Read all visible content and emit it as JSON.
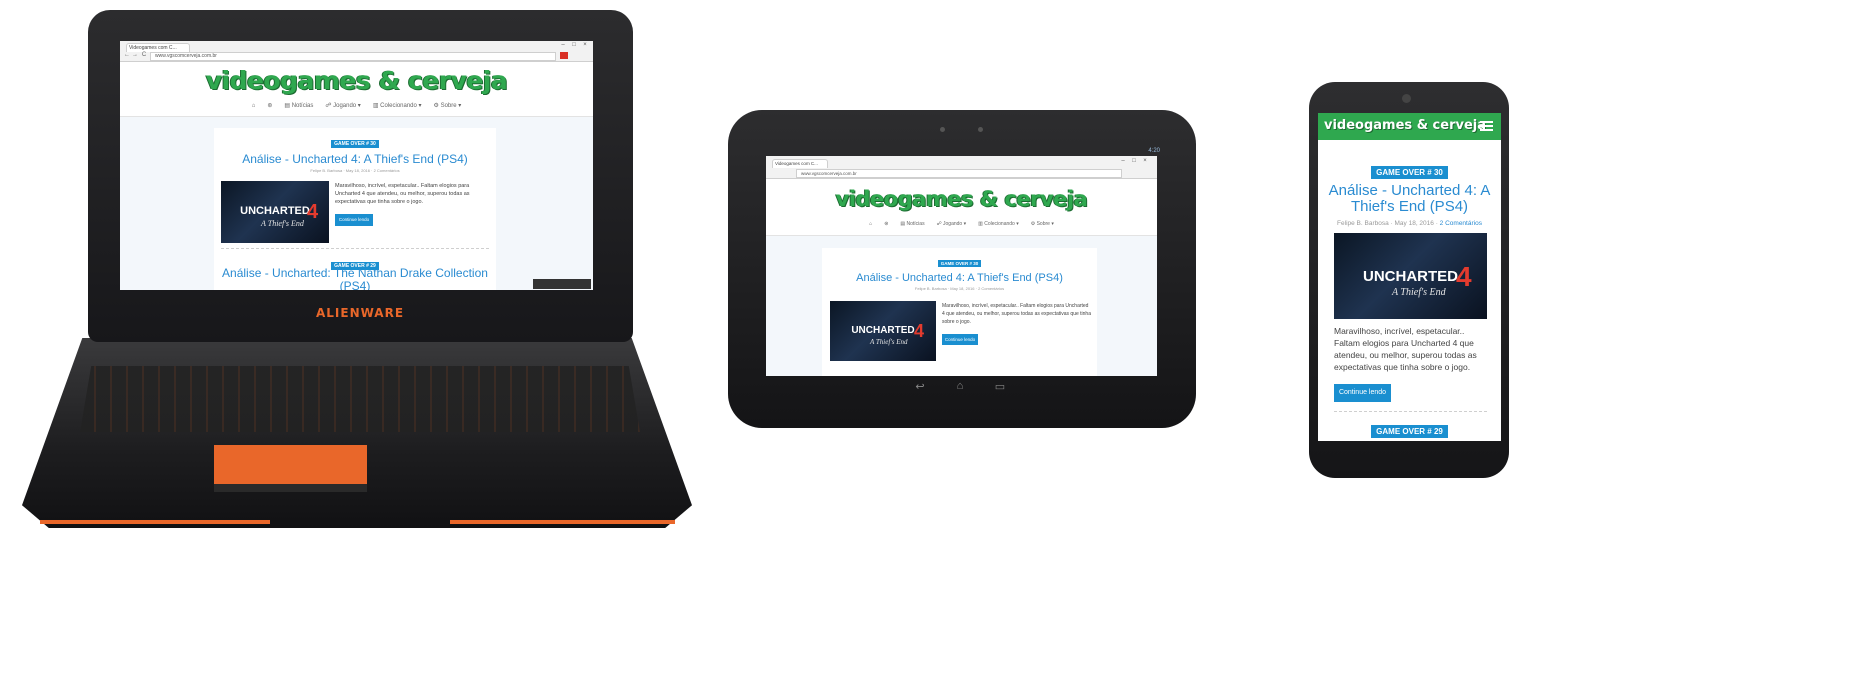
{
  "brand": {
    "laptop_logo": "ALIENWARE",
    "accent": "#e9672a",
    "site_green": "#2fa84f",
    "link_blue": "#2a8bd1",
    "badge_blue": "#1a8fd0"
  },
  "browser": {
    "tab_title": "Videogames com C...",
    "url": "www.vgscomcerveja.com.br",
    "win_buttons": [
      "–",
      "□",
      "×"
    ],
    "nav_icons": [
      "←",
      "→",
      "C"
    ]
  },
  "site": {
    "logo": "videogames & cerveja",
    "menu": [
      "⌂",
      "⊛",
      "▤ Notícias",
      "☍ Jogando ▾",
      "▥ Colecionando ▾",
      "⚙ Sobre ▾"
    ]
  },
  "posts": [
    {
      "badge": "GAME OVER # 30",
      "title": "Análise - Uncharted 4: A Thief's End (PS4)",
      "author": "Felipe B. Barbosa",
      "date": "May 18, 2016",
      "comments": "2 Comentários",
      "excerpt": "Maravilhoso, incrível, espetacular.. Faltam elogios para Uncharted 4 que atendeu, ou melhor, superou todas as expectativas que tinha sobre o jogo.",
      "cta": "Continue lendo",
      "thumb_title": "UNCHARTED",
      "thumb_sub": "A Thief's End",
      "thumb_num": "4"
    },
    {
      "badge": "GAME OVER # 29",
      "title": "Análise - Uncharted: The Nathan Drake Collection (PS4)"
    }
  ],
  "tablet": {
    "status_time": "4:20",
    "nav_buttons": [
      "↩",
      "⌂",
      "▭"
    ]
  },
  "phone": {
    "menu_icon": "hamburger-icon"
  }
}
